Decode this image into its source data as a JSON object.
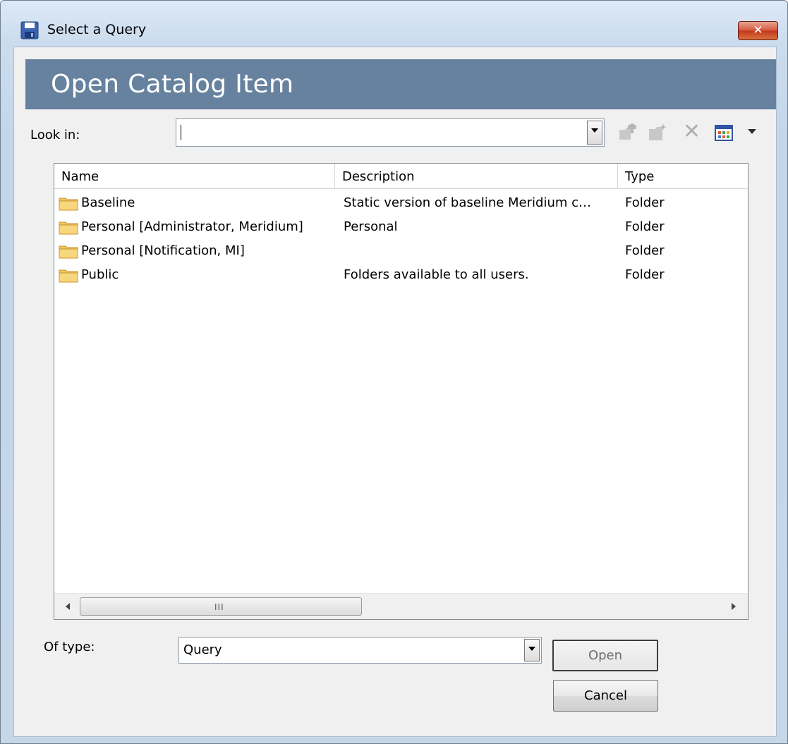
{
  "window": {
    "title": "Select a Query",
    "title_icon": "save-disk-icon",
    "close_glyph": "✕"
  },
  "banner": {
    "title": "Open Catalog Item"
  },
  "look_in": {
    "label": "Look in:",
    "value": ""
  },
  "toolbar": {
    "icons": [
      "up-folder-icon",
      "new-folder-icon",
      "delete-icon",
      "view-menu-icon",
      "dropdown-arrow-icon"
    ],
    "delete_glyph": "✕"
  },
  "list": {
    "columns": [
      "Name",
      "Description",
      "Type"
    ],
    "rows": [
      {
        "name": "Baseline",
        "description": "Static version of baseline Meridium c…",
        "type": "Folder"
      },
      {
        "name": "Personal [Administrator, Meridium]",
        "description": "Personal",
        "type": "Folder"
      },
      {
        "name": "Personal [Notification, MI]",
        "description": "",
        "type": "Folder"
      },
      {
        "name": "Public",
        "description": "Folders available to all users.",
        "type": "Folder"
      }
    ],
    "scrollbar_grip": "III"
  },
  "of_type": {
    "label": "Of type:",
    "value": "Query"
  },
  "buttons": {
    "open": "Open",
    "cancel": "Cancel"
  },
  "colors": {
    "banner": "#66829f",
    "close": "#c23a1d",
    "folder": "#f2c760"
  }
}
